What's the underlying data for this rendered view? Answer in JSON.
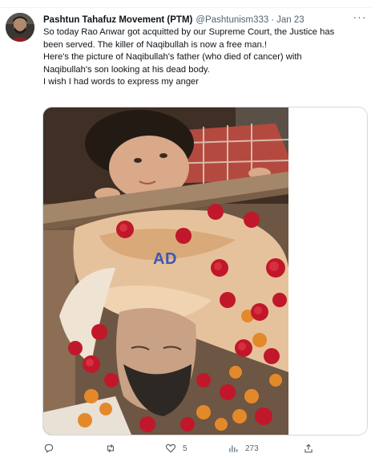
{
  "tweet": {
    "author_name": "Pashtun Tahafuz Movement (PTM)",
    "handle": "@Pashtunism333",
    "separator": "·",
    "date": "Jan 23",
    "more_glyph": "···",
    "lines": [
      "So today Rao Anwar got acquitted by our Supreme Court, the Justice has",
      "been served. The killer of Naqibullah is now a free man.!",
      "Here's the picture of Naqibullah's father (who died of cancer) with",
      "Naqibullah's son looking at his dead body.",
      "I wish I had words to express my anger"
    ],
    "media_watermark": "AD"
  },
  "actions": {
    "reply_count": "",
    "retweet_count": "",
    "like_count": "5",
    "views_count": "273"
  },
  "colors": {
    "text": "#0f1419",
    "secondary": "#536471",
    "border": "#cfd9de",
    "watermark": "#3b58b8"
  }
}
